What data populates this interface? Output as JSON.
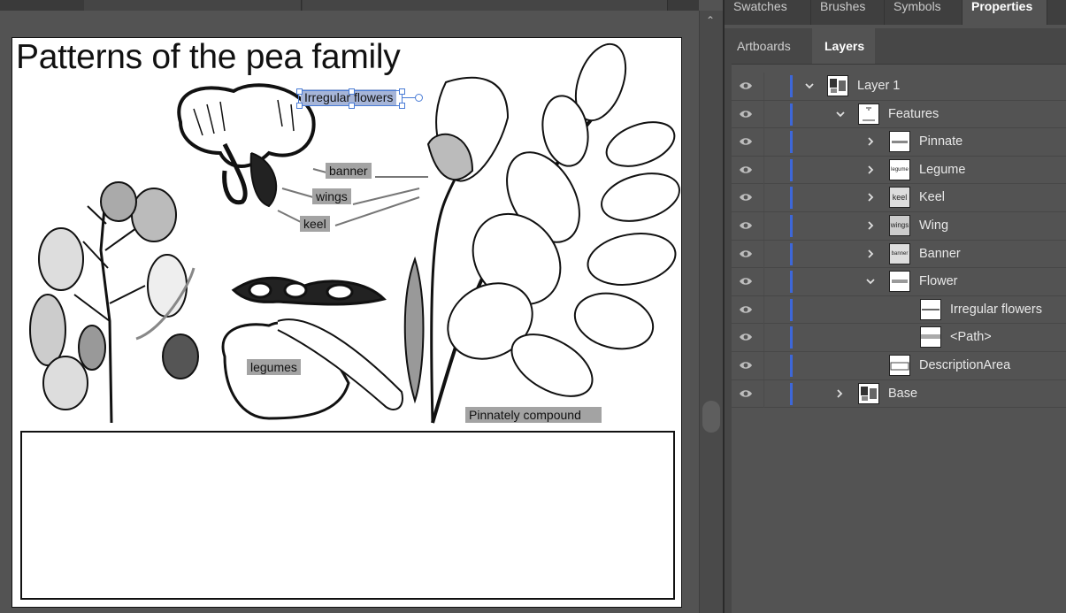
{
  "canvas": {
    "title": "Patterns of the pea family",
    "labels": {
      "irregular": "Irregular flowers",
      "banner": "banner",
      "wings": "wings",
      "keel": "keel",
      "legumes": "legumes",
      "pinnately": "Pinnately compound"
    }
  },
  "panel_tabs": [
    "Swatches",
    "Brushes",
    "Symbols",
    "Properties"
  ],
  "sub_tabs": [
    "Artboards",
    "Layers"
  ],
  "layers": [
    {
      "label": "Layer 1",
      "expanded": true
    },
    {
      "label": "Features",
      "expanded": true
    },
    {
      "label": "Pinnate",
      "expanded": false
    },
    {
      "label": "Legume",
      "expanded": false
    },
    {
      "label": "Keel",
      "expanded": false
    },
    {
      "label": "Wing",
      "expanded": false
    },
    {
      "label": "Banner",
      "expanded": false
    },
    {
      "label": "Flower",
      "expanded": true
    },
    {
      "label": "Irregular flowers"
    },
    {
      "label": "<Path>"
    },
    {
      "label": "DescriptionArea"
    },
    {
      "label": "Base",
      "expanded": false
    }
  ],
  "thumb_text": {
    "legume": "legume",
    "keel": "keel",
    "wing": "wings",
    "banner": "banner"
  },
  "colors": {
    "layer_color": "#3d67d9",
    "selection": "#4a7cd6"
  }
}
